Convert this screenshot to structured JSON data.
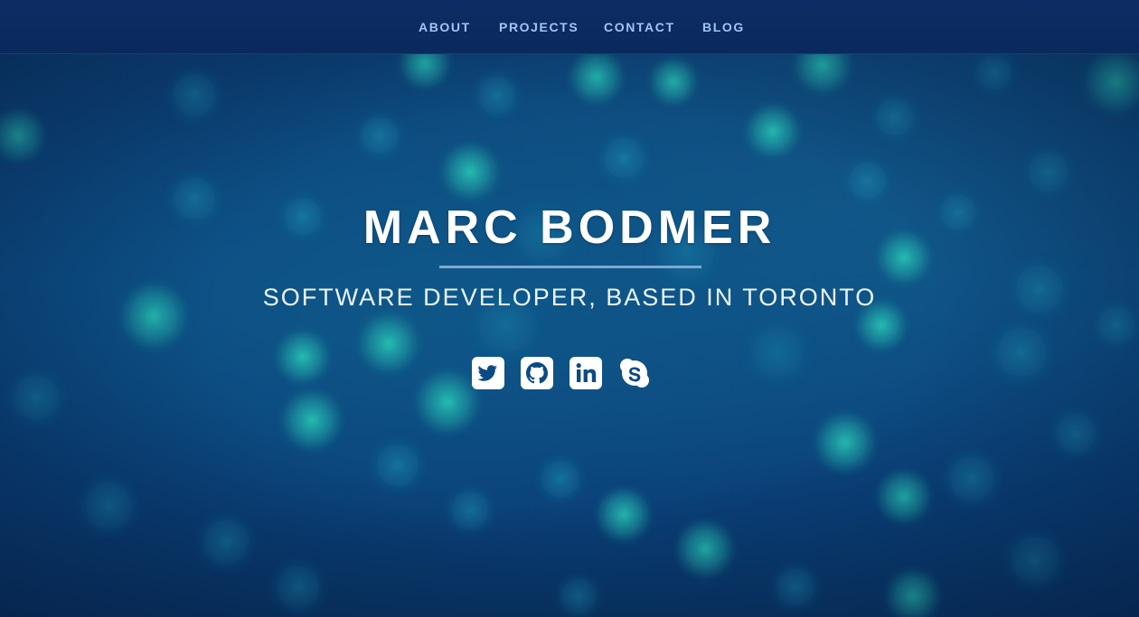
{
  "nav": {
    "items": [
      {
        "label": "ABOUT"
      },
      {
        "label": "PROJECTS"
      },
      {
        "label": "CONTACT"
      },
      {
        "label": "BLOG"
      }
    ]
  },
  "hero": {
    "name": "MARC BODMER",
    "tagline": "SOFTWARE DEVELOPER, BASED IN TORONTO",
    "social": [
      {
        "icon": "twitter-icon"
      },
      {
        "icon": "github-icon"
      },
      {
        "icon": "linkedin-icon"
      },
      {
        "icon": "skype-icon"
      }
    ]
  },
  "colors": {
    "nav_background": "#0b2b5f",
    "nav_link": "#9fc6f2",
    "hero_background": "#0c4a84",
    "bokeh_light": "#22b5a8",
    "text": "#ffffff",
    "divider": "#7fa8cf"
  }
}
